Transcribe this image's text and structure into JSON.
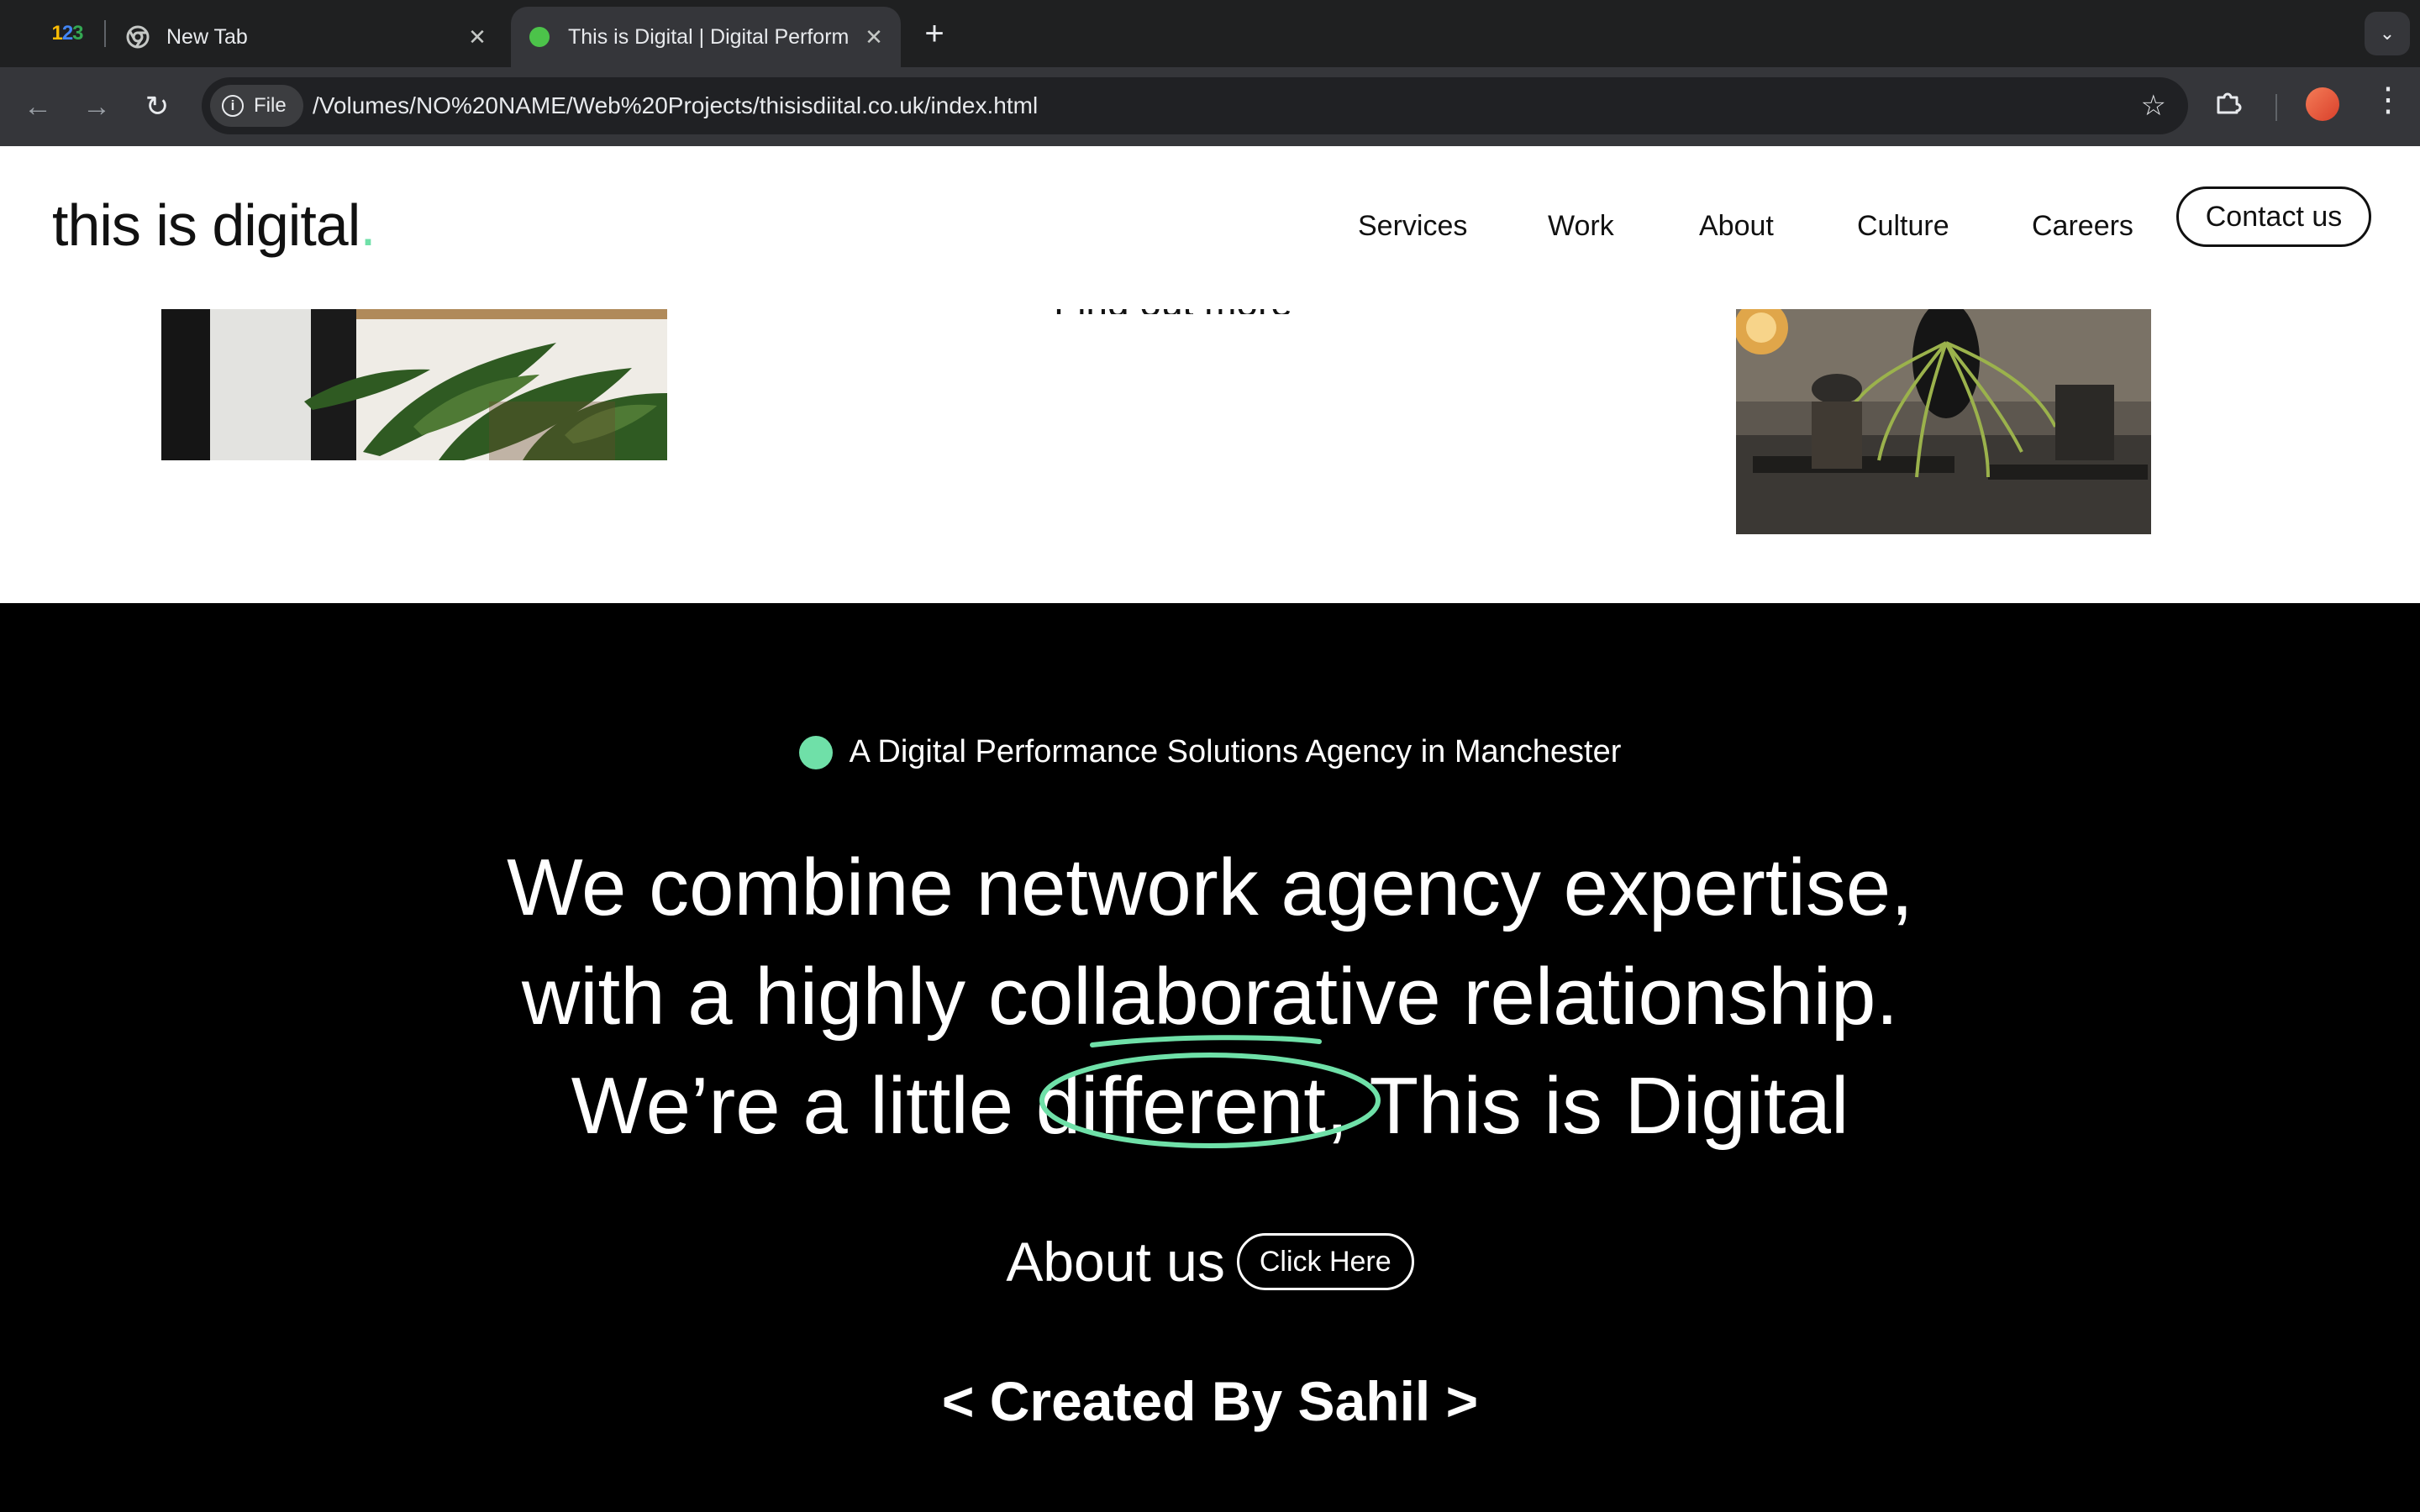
{
  "browser": {
    "pinned_tab_label": "123",
    "tabs": [
      {
        "title": "New Tab",
        "active": false
      },
      {
        "title": "This is Digital | Digital Perform",
        "active": true
      }
    ],
    "address": {
      "scheme_label": "File",
      "url": "/Volumes/NO%20NAME/Web%20Projects/thisisdiital.co.uk/index.html"
    },
    "icons": {
      "back": "back-arrow-icon",
      "forward": "forward-arrow-icon",
      "reload": "reload-icon",
      "info": "info-icon",
      "star": "bookmark-star-icon",
      "extensions": "puzzle-icon",
      "menu": "three-dot-menu-icon",
      "tab_search": "chevron-down-icon",
      "close": "close-icon",
      "new_tab": "plus-icon"
    }
  },
  "site": {
    "logo": {
      "text": "this is digital",
      "dot": "."
    },
    "nav": [
      "Services",
      "Work",
      "About",
      "Culture",
      "Careers"
    ],
    "contact_label": "Contact us",
    "partial_link": "Find out more",
    "eyebrow": "A Digital Performance Solutions Agency in Manchester",
    "headline": {
      "line1": "We combine network agency expertise,",
      "line2": "with a highly collaborative relationship.",
      "line3_before": "We’re a little ",
      "line3_circled": "different,",
      "line3_after": " This is Digital"
    },
    "about_label": "About us",
    "about_button": "Click Here",
    "credit": "< Created By Sahil >"
  },
  "colors": {
    "accent": "#6fe0a8",
    "page_bg": "#000000",
    "header_bg": "#ffffff",
    "tab_favicon": "#4cc34a"
  }
}
